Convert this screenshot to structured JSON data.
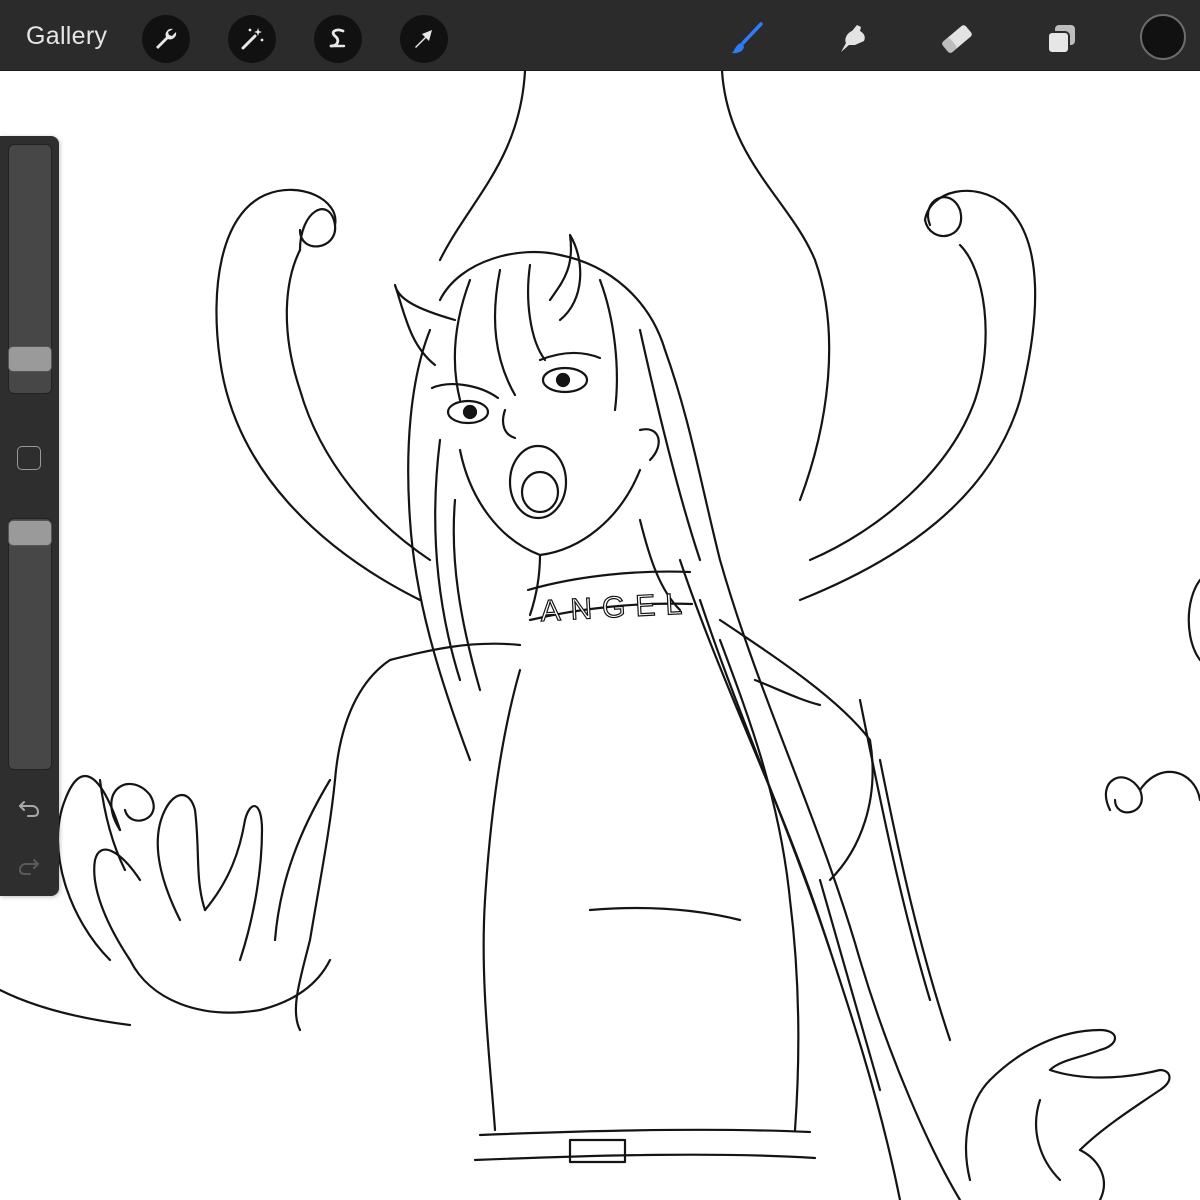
{
  "toolbar": {
    "gallery_label": "Gallery",
    "left_tools": [
      "actions-icon",
      "adjustments-icon",
      "selection-icon",
      "transform-icon"
    ],
    "right_tools": [
      "brush-icon",
      "smudge-icon",
      "eraser-icon",
      "layers-icon",
      "color-icon"
    ],
    "active_tool": "brush-icon",
    "accent_color": "#2f7bf5",
    "current_color": "#111111"
  },
  "sidebar": {
    "brush_size_level": 0.1,
    "opacity_level": 1.0,
    "controls": [
      "brush-size-slider",
      "modify-button",
      "opacity-slider",
      "undo-icon",
      "redo-icon"
    ]
  },
  "canvas": {
    "collar_text": "ANGEL",
    "background_color": "#ffffff",
    "line_color": "#141414"
  }
}
